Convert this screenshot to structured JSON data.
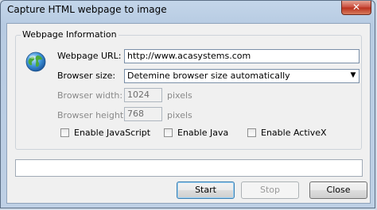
{
  "window": {
    "title": "Capture HTML webpage to image",
    "close_glyph": "✕"
  },
  "group": {
    "title": "Webpage Information",
    "icon": "globe-icon"
  },
  "url": {
    "label": "Webpage URL:",
    "value": "http://www.acasystems.com"
  },
  "browser_size": {
    "label": "Browser size:",
    "selected": "Detemine browser size automatically",
    "arrow_glyph": "▼"
  },
  "width": {
    "label": "Browser width:",
    "value": "1024",
    "unit": "pixels",
    "enabled": false
  },
  "height": {
    "label": "Browser height:",
    "value": "768",
    "unit": "pixels",
    "enabled": false
  },
  "options": [
    {
      "label": "Enable JavaScript",
      "checked": false
    },
    {
      "label": "Enable Java",
      "checked": false
    },
    {
      "label": "Enable ActiveX",
      "checked": false
    }
  ],
  "status": {
    "value": ""
  },
  "buttons": {
    "start": "Start",
    "stop": "Stop",
    "close": "Close"
  }
}
